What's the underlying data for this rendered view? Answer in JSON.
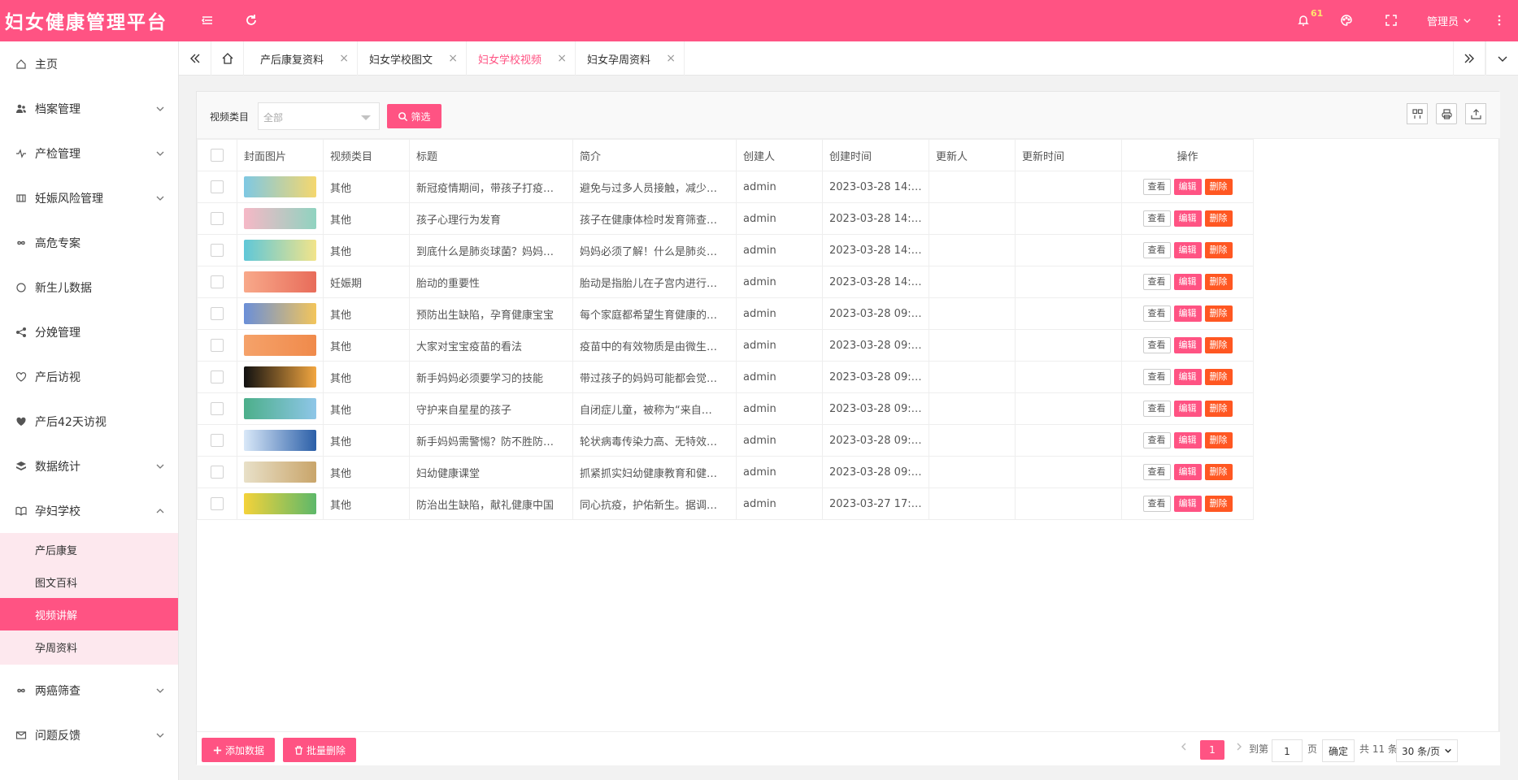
{
  "app": {
    "title": "妇女健康管理平台"
  },
  "header": {
    "notification_count": "61",
    "user": "管理员"
  },
  "sidebar": {
    "items": [
      {
        "label": "主页",
        "icon": "home-icon"
      },
      {
        "label": "档案管理",
        "icon": "users-icon"
      },
      {
        "label": "产检管理",
        "icon": "pulse-icon"
      },
      {
        "label": "妊娠风险管理",
        "icon": "table-icon"
      },
      {
        "label": "高危专案",
        "icon": "infinity-icon"
      },
      {
        "label": "新生儿数据",
        "icon": "circle-icon"
      },
      {
        "label": "分娩管理",
        "icon": "share-icon"
      },
      {
        "label": "产后访视",
        "icon": "heart-outline-icon"
      },
      {
        "label": "产后42天访视",
        "icon": "heart-icon"
      },
      {
        "label": "数据统计",
        "icon": "layers-icon"
      },
      {
        "label": "孕妇学校",
        "icon": "book-icon"
      },
      {
        "label": "两癌筛查",
        "icon": "infinity-icon"
      },
      {
        "label": "问题反馈",
        "icon": "mail-icon"
      }
    ],
    "subitems": [
      {
        "label": "产后康复"
      },
      {
        "label": "图文百科"
      },
      {
        "label": "视频讲解"
      },
      {
        "label": "孕周资料"
      }
    ]
  },
  "tabs": [
    {
      "label": "产后康复资料"
    },
    {
      "label": "妇女学校图文"
    },
    {
      "label": "妇女学校视频"
    },
    {
      "label": "妇女孕周资料"
    }
  ],
  "filter": {
    "label": "视频类目",
    "select_value": "全部",
    "button": "筛选"
  },
  "table": {
    "headers": [
      "封面图片",
      "视频类目",
      "标题",
      "简介",
      "创建人",
      "创建时间",
      "更新人",
      "更新时间",
      "操作"
    ],
    "actions": {
      "view": "查看",
      "edit": "编辑",
      "delete": "删除"
    },
    "rows": [
      {
        "category": "其他",
        "title": "新冠疫情期间，带孩子打疫…",
        "intro": "避免与过多人员接触，减少…",
        "creator": "admin",
        "created": "2023-03-28 14:…",
        "thumb": [
          "#7ec8e3",
          "#f5d76e"
        ]
      },
      {
        "category": "其他",
        "title": "孩子心理行为发育",
        "intro": "孩子在健康体检时发育筛查…",
        "creator": "admin",
        "created": "2023-03-28 14:…",
        "thumb": [
          "#f6b8c6",
          "#8fd3c0"
        ]
      },
      {
        "category": "其他",
        "title": "到底什么是肺炎球菌？妈妈…",
        "intro": "妈妈必须了解！什么是肺炎…",
        "creator": "admin",
        "created": "2023-03-28 14:…",
        "thumb": [
          "#5fc7d8",
          "#f2e48a"
        ]
      },
      {
        "category": "妊娠期",
        "title": "胎动的重要性",
        "intro": "胎动是指胎儿在子宫内进行…",
        "creator": "admin",
        "created": "2023-03-28 14:…",
        "thumb": [
          "#f8a98a",
          "#e86c5a"
        ]
      },
      {
        "category": "其他",
        "title": "预防出生缺陷，孕育健康宝宝",
        "intro": "每个家庭都希望生育健康的…",
        "creator": "admin",
        "created": "2023-03-28 09:…",
        "thumb": [
          "#6a8fd8",
          "#f3c55b"
        ]
      },
      {
        "category": "其他",
        "title": "大家对宝宝疫苗的看法",
        "intro": "疫苗中的有效物质是由微生…",
        "creator": "admin",
        "created": "2023-03-28 09:…",
        "thumb": [
          "#f5a26a",
          "#f08a4b"
        ]
      },
      {
        "category": "其他",
        "title": "新手妈妈必须要学习的技能",
        "intro": "带过孩子的妈妈可能都会觉…",
        "creator": "admin",
        "created": "2023-03-28 09:…",
        "thumb": [
          "#111111",
          "#f2a640"
        ]
      },
      {
        "category": "其他",
        "title": "守护来自星星的孩子",
        "intro": "自闭症儿童，被称为“来自…",
        "creator": "admin",
        "created": "2023-03-28 09:…",
        "thumb": [
          "#4caf8a",
          "#8ec6e8"
        ]
      },
      {
        "category": "其他",
        "title": "新手妈妈需警惕？防不胜防…",
        "intro": "轮状病毒传染力高、无特效…",
        "creator": "admin",
        "created": "2023-03-28 09:…",
        "thumb": [
          "#d9e8f8",
          "#2b5fa8"
        ]
      },
      {
        "category": "其他",
        "title": "妇幼健康课堂",
        "intro": "抓紧抓实妇幼健康教育和健…",
        "creator": "admin",
        "created": "2023-03-28 09:…",
        "thumb": [
          "#e8e0c8",
          "#c9a56a"
        ]
      },
      {
        "category": "其他",
        "title": "防治出生缺陷，献礼健康中国",
        "intro": "同心抗疫，护佑新生。据调…",
        "creator": "admin",
        "created": "2023-03-27 17:…",
        "thumb": [
          "#f4d23a",
          "#5db86a"
        ]
      }
    ]
  },
  "footer": {
    "add_button": "添加数据",
    "batch_delete_button": "批量删除",
    "current_page": "1",
    "goto_label": "到第",
    "goto_value": "1",
    "page_unit": "页",
    "confirm": "确定",
    "total": "共 11 条",
    "page_size": "30 条/页"
  },
  "colors": {
    "brand": "#ff5383",
    "delete": "#ff5722"
  }
}
